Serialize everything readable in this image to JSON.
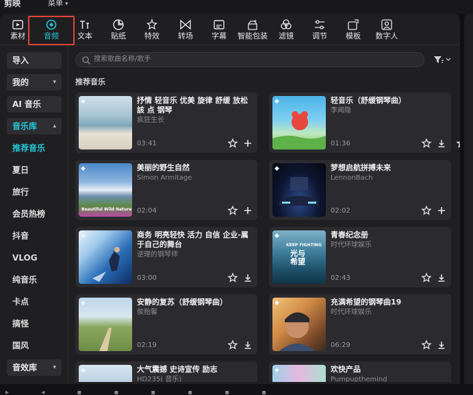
{
  "app": {
    "title": "剪映",
    "menu_label": "菜单"
  },
  "colors": {
    "accent": "#22c7d6",
    "highlight_border": "#e0463a",
    "panel": "#1f1f22",
    "card": "#2b2b2f"
  },
  "toolbar": {
    "tabs": [
      {
        "label": "素材",
        "icon": "media-icon"
      },
      {
        "label": "音频",
        "icon": "audio-icon",
        "active": true
      },
      {
        "label": "文本",
        "icon": "text-icon"
      },
      {
        "label": "贴纸",
        "icon": "sticker-icon"
      },
      {
        "label": "特效",
        "icon": "effects-icon"
      },
      {
        "label": "转场",
        "icon": "transition-icon"
      },
      {
        "label": "字幕",
        "icon": "subtitle-icon"
      },
      {
        "label": "智能包装",
        "icon": "smart-package-icon"
      },
      {
        "label": "滤镜",
        "icon": "filter-icon"
      },
      {
        "label": "调节",
        "icon": "adjust-icon"
      },
      {
        "label": "模板",
        "icon": "template-icon"
      },
      {
        "label": "数字人",
        "icon": "digital-human-icon"
      }
    ]
  },
  "sidebar": {
    "import_label": "导入",
    "mine_label": "我的",
    "ai_music_label": "AI 音乐",
    "music_library_label": "音乐库",
    "items": [
      "推荐音乐",
      "夏日",
      "旅行",
      "会员热榜",
      "抖音",
      "VLOG",
      "纯音乐",
      "卡点",
      "搞怪",
      "国风"
    ],
    "sfx_library_label": "音效库"
  },
  "search": {
    "placeholder": "搜索歌曲名称/歌手"
  },
  "main": {
    "section_title": "推荐音乐",
    "cards": [
      {
        "title": "抒情 轻音乐 优美 旋律 舒缓 放松 該 点 钢琴",
        "artist": "疯狂生长",
        "duration": "03:41",
        "action": "add"
      },
      {
        "title": "轻音乐（舒缓钢琴曲）",
        "artist": "李闻隐",
        "duration": "01:36",
        "action": "download"
      },
      {
        "title": "美丽的野生自然",
        "artist": "Simon Armitage",
        "duration": "02:04",
        "action": "add",
        "thumb_text": "Beautiful Wild Nature"
      },
      {
        "title": "梦想启航拼搏未来",
        "artist": "LennonBach",
        "duration": "02:02",
        "action": "add"
      },
      {
        "title": "商务 明亮轻快 活力 自信 企业-属于自己的舞台",
        "artist": "逆理的钢琴师",
        "duration": "03:00",
        "action": "download"
      },
      {
        "title": "青春纪念册",
        "artist": "时代环球娱乐",
        "duration": "02:43",
        "action": "download",
        "thumb_text": "KEEP FIGHTING",
        "thumb_text2": "光与希望"
      },
      {
        "title": "安静的复苏（舒缓钢琴曲）",
        "artist": "侯贻馨",
        "duration": "02:19",
        "action": "download"
      },
      {
        "title": "充满希望的钢琴曲19",
        "artist": "时代环球娱乐",
        "duration": "06:29",
        "action": "download"
      },
      {
        "title": "大气震撼 史诗宣传 励志",
        "artist": "HD235( 音乐)",
        "duration": "",
        "action": ""
      },
      {
        "title": "欢快产品",
        "artist": "Pumpupthemind",
        "duration": "",
        "action": ""
      }
    ]
  }
}
